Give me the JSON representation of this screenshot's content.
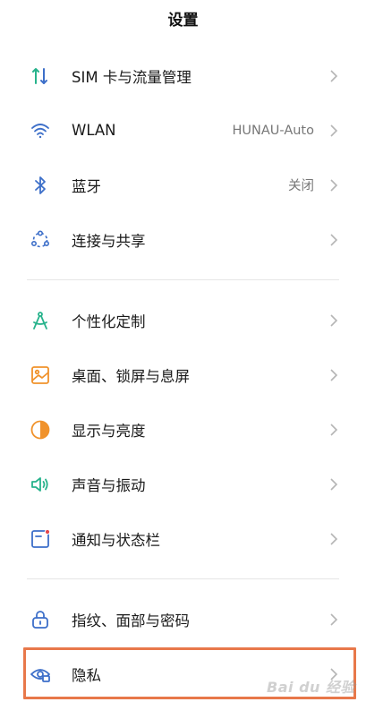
{
  "header": {
    "title": "设置"
  },
  "groups": [
    {
      "items": [
        {
          "label": "SIM 卡与流量管理",
          "value": "",
          "icon": "sim-data-icon"
        },
        {
          "label": "WLAN",
          "value": "HUNAU-Auto",
          "icon": "wifi-icon"
        },
        {
          "label": "蓝牙",
          "value": "关闭",
          "icon": "bluetooth-icon"
        },
        {
          "label": "连接与共享",
          "value": "",
          "icon": "share-connection-icon"
        }
      ]
    },
    {
      "items": [
        {
          "label": "个性化定制",
          "value": "",
          "icon": "compass-icon"
        },
        {
          "label": "桌面、锁屏与息屏",
          "value": "",
          "icon": "wallpaper-icon"
        },
        {
          "label": "显示与亮度",
          "value": "",
          "icon": "brightness-icon"
        },
        {
          "label": "声音与振动",
          "value": "",
          "icon": "speaker-icon"
        },
        {
          "label": "通知与状态栏",
          "value": "",
          "icon": "notification-icon"
        }
      ]
    },
    {
      "items": [
        {
          "label": "指纹、面部与密码",
          "value": "",
          "icon": "lock-icon"
        },
        {
          "label": "隐私",
          "value": "",
          "icon": "privacy-eye-icon"
        }
      ]
    }
  ],
  "watermark": {
    "text": "Bai du 经验"
  },
  "colors": {
    "accent_green": "#27b38c",
    "accent_blue": "#3d6fc9",
    "accent_orange": "#f0922b",
    "highlight_border": "#e8784a"
  }
}
